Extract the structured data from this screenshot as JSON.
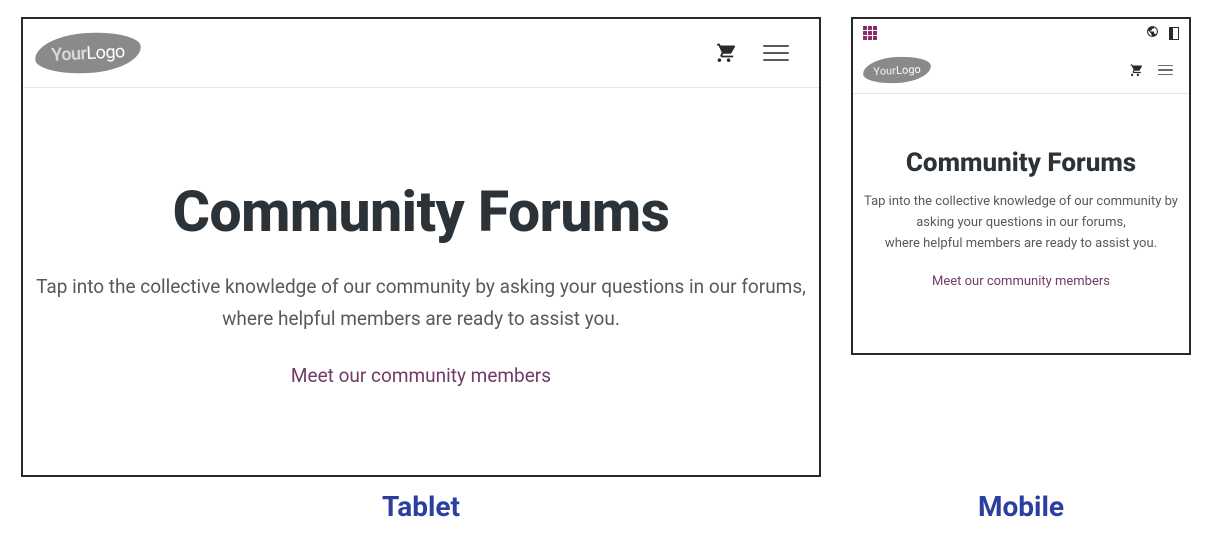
{
  "logo": {
    "part1": "Your",
    "part2": "Logo"
  },
  "content": {
    "title": "Community Forums",
    "subtitle_line1": "Tap into the collective knowledge of our community by asking your questions in our forums,",
    "subtitle_line2": "where helpful members are ready to assist you.",
    "cta_link": "Meet our community members"
  },
  "labels": {
    "tablet": "Tablet",
    "mobile": "Mobile"
  },
  "colors": {
    "heading": "#2c3338",
    "body": "#535a60",
    "link": "#723a67",
    "caption": "#2c3fa0",
    "logo_bg": "#8a8a8a"
  }
}
